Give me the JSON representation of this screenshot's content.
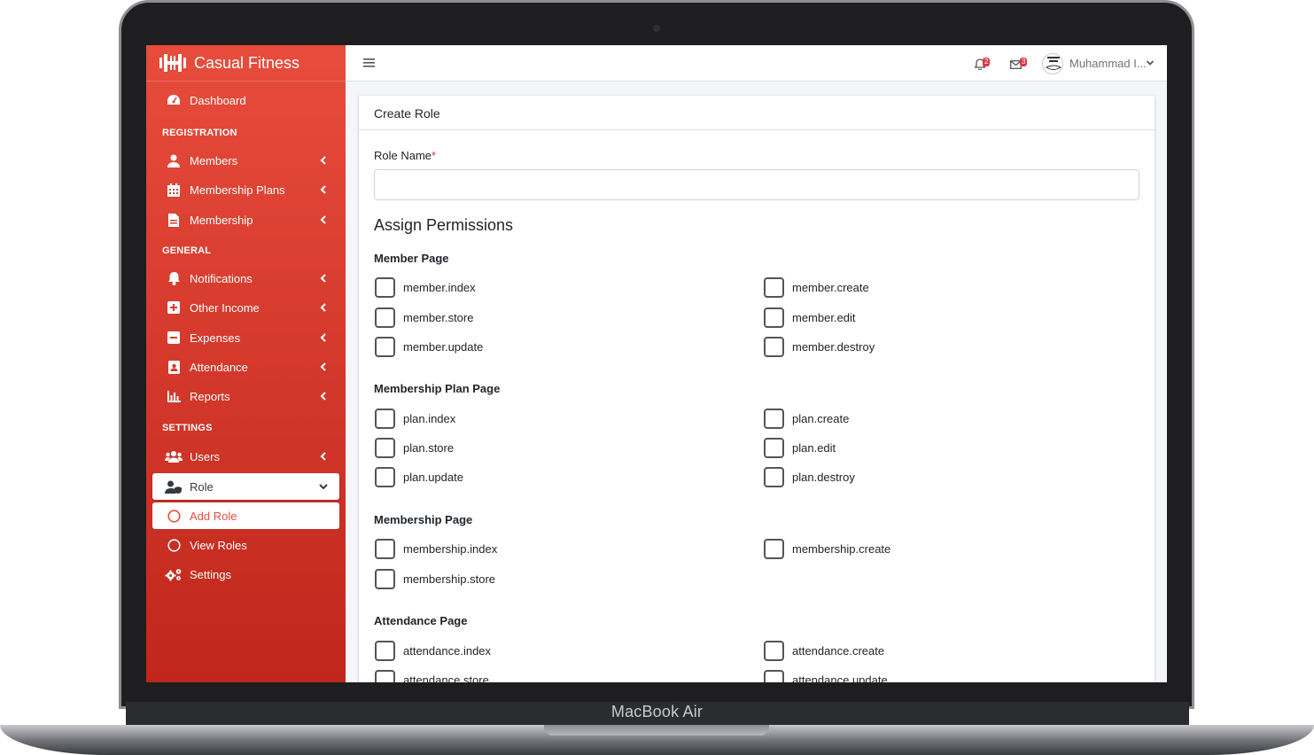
{
  "device": {
    "label": "MacBook Air"
  },
  "brand": {
    "name": "Casual Fitness"
  },
  "sidebar": {
    "dashboard": "Dashboard",
    "sections": {
      "registration": "REGISTRATION",
      "general": "GENERAL",
      "settings": "SETTINGS"
    },
    "items": {
      "members": "Members",
      "membership_plans": "Membership Plans",
      "membership": "Membership",
      "notifications": "Notifications",
      "other_income": "Other Income",
      "expenses": "Expenses",
      "attendance": "Attendance",
      "reports": "Reports",
      "users": "Users",
      "role": "Role",
      "add_role": "Add Role",
      "view_roles": "View Roles",
      "settings": "Settings"
    }
  },
  "topbar": {
    "notifications_count": "2",
    "messages_count": "3",
    "user_name": "Muhammad I..."
  },
  "card": {
    "title": "Create Role",
    "role_name_label": "Role Name",
    "required_mark": "*",
    "role_name_value": "",
    "assign_heading": "Assign Permissions"
  },
  "groups": [
    {
      "title": "Member Page",
      "perms": [
        "member.index",
        "member.create",
        "member.store",
        "member.edit",
        "member.update",
        "member.destroy"
      ]
    },
    {
      "title": "Membership Plan Page",
      "perms": [
        "plan.index",
        "plan.create",
        "plan.store",
        "plan.edit",
        "plan.update",
        "plan.destroy"
      ]
    },
    {
      "title": "Membership Page",
      "perms": [
        "membership.index",
        "membership.create",
        "membership.store"
      ]
    },
    {
      "title": "Attendance Page",
      "perms": [
        "attendance.index",
        "attendance.create",
        "attendance.store",
        "attendance.update"
      ]
    }
  ],
  "colors": {
    "accent": "#e74c3c",
    "accent_dark": "#c0261b"
  }
}
